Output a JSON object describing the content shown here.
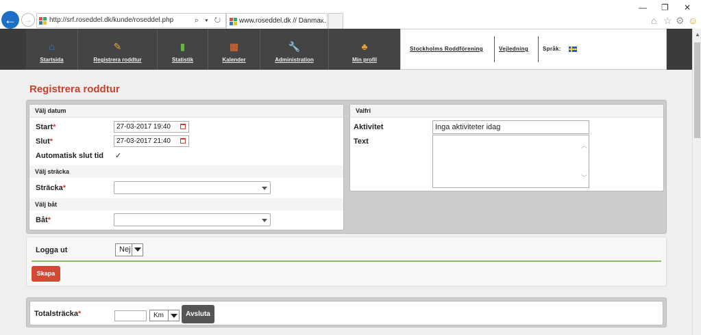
{
  "browser": {
    "address": "http://srf.roseddel.dk/kunde/roseddel.php",
    "address_tools": "⌕ ▾ ↻",
    "tab_title": "www.roseddel.dk // Danma...",
    "tab_close": "×",
    "back_glyph": "←",
    "forward_glyph": "→",
    "min_glyph": "—",
    "restore_glyph": "❐",
    "close_glyph": "✕",
    "home_glyph": "⌂",
    "star_glyph": "☆",
    "gear_glyph": "⚙",
    "smiley_glyph": "☺"
  },
  "nav": {
    "items": [
      {
        "label": "Startsida",
        "icon": "house-icon",
        "glyph": "⌂",
        "color": "#3d7fd0"
      },
      {
        "label": "Registrera roddtur",
        "icon": "pencil-icon",
        "glyph": "✎",
        "color": "#e8a23c"
      },
      {
        "label": "Statistik",
        "icon": "bar-chart-icon",
        "glyph": "▮",
        "color": "#6ab04c"
      },
      {
        "label": "Kalender",
        "icon": "calendar-icon",
        "glyph": "▦",
        "color": "#d9774a"
      },
      {
        "label": "Administration",
        "icon": "wrench-icon",
        "glyph": "🔧",
        "color": "#dddddd"
      },
      {
        "label": "Min profil",
        "icon": "profile-icon",
        "glyph": "♣",
        "color": "#f0a030"
      }
    ]
  },
  "topright": {
    "club": "Stockholms Roddförening",
    "help": "Vejledning",
    "language_label": "Språk:"
  },
  "page": {
    "title": "Registrera roddtur"
  },
  "form": {
    "date_header": "Välj datum",
    "start_label": "Start",
    "start_value": "27-03-2017 19:40",
    "end_label": "Slut",
    "end_value": "27-03-2017 21:40",
    "auto_end_label": "Automatisk slut tid",
    "auto_end_checked": "✓",
    "route_header": "Välj sträcka",
    "route_label": "Sträcka",
    "boat_header": "Välj båt",
    "boat_label": "Båt",
    "required_mark": "*"
  },
  "optional": {
    "header": "Valfri",
    "activity_label": "Aktivitet",
    "activity_value": "Inga aktiviteter idag",
    "text_label": "Text"
  },
  "logout": {
    "label": "Logga ut",
    "value": "Nej",
    "create_button": "Skapa"
  },
  "total": {
    "label": "Totalsträcka",
    "unit": "Km",
    "finish_button": "Avsluta"
  },
  "colors": {
    "accent_red": "#c8412b",
    "nav_bg": "#444444",
    "green_rule": "#8cbf6a"
  }
}
